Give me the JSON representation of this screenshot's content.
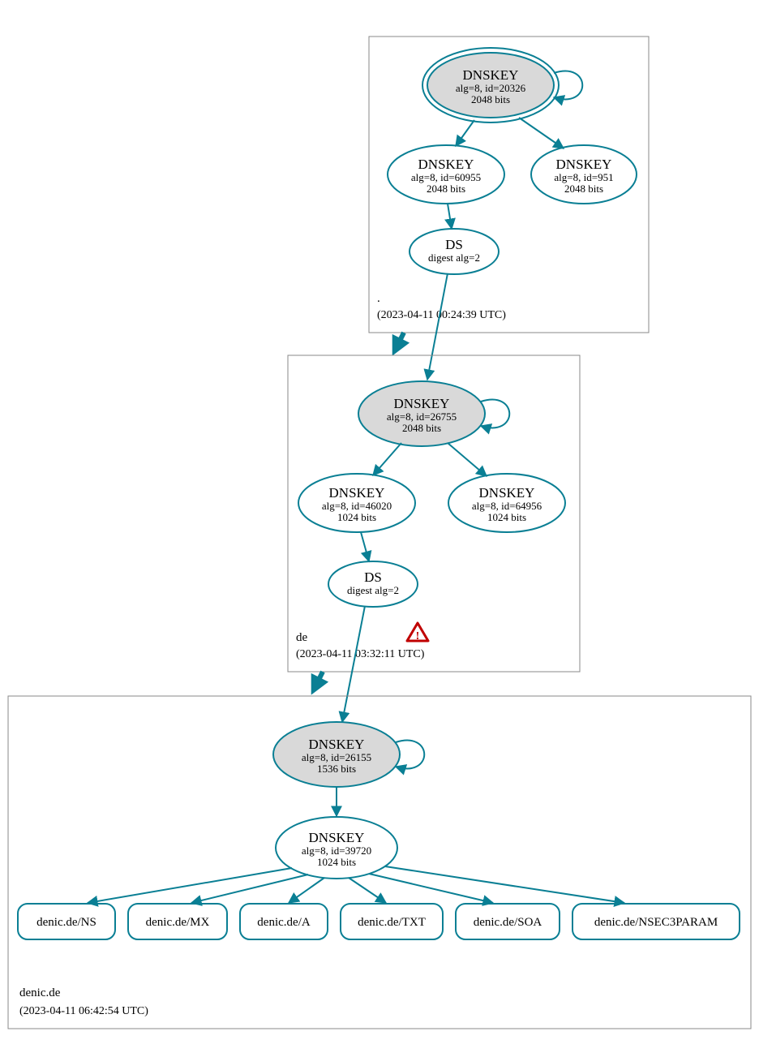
{
  "colors": {
    "teal": "#0a7f94",
    "gray_border": "#888888",
    "node_fill_ksk": "#d9d9d9",
    "warn_red": "#c00000"
  },
  "zones": {
    "root": {
      "label": ".",
      "timestamp": "(2023-04-11 00:24:39 UTC)",
      "nodes": {
        "ksk": {
          "title": "DNSKEY",
          "line1": "alg=8, id=20326",
          "line2": "2048 bits"
        },
        "zsk1": {
          "title": "DNSKEY",
          "line1": "alg=8, id=60955",
          "line2": "2048 bits"
        },
        "zsk2": {
          "title": "DNSKEY",
          "line1": "alg=8, id=951",
          "line2": "2048 bits"
        },
        "ds": {
          "title": "DS",
          "line1": "digest alg=2"
        }
      }
    },
    "de": {
      "label": "de",
      "timestamp": "(2023-04-11 03:32:11 UTC)",
      "nodes": {
        "ksk": {
          "title": "DNSKEY",
          "line1": "alg=8, id=26755",
          "line2": "2048 bits"
        },
        "zsk1": {
          "title": "DNSKEY",
          "line1": "alg=8, id=46020",
          "line2": "1024 bits"
        },
        "zsk2": {
          "title": "DNSKEY",
          "line1": "alg=8, id=64956",
          "line2": "1024 bits"
        },
        "ds": {
          "title": "DS",
          "line1": "digest alg=2"
        }
      },
      "warning": true
    },
    "denic": {
      "label": "denic.de",
      "timestamp": "(2023-04-11 06:42:54 UTC)",
      "nodes": {
        "ksk": {
          "title": "DNSKEY",
          "line1": "alg=8, id=26155",
          "line2": "1536 bits"
        },
        "zsk": {
          "title": "DNSKEY",
          "line1": "alg=8, id=39720",
          "line2": "1024 bits"
        }
      },
      "records": [
        "denic.de/NS",
        "denic.de/MX",
        "denic.de/A",
        "denic.de/TXT",
        "denic.de/SOA",
        "denic.de/NSEC3PARAM"
      ]
    }
  }
}
